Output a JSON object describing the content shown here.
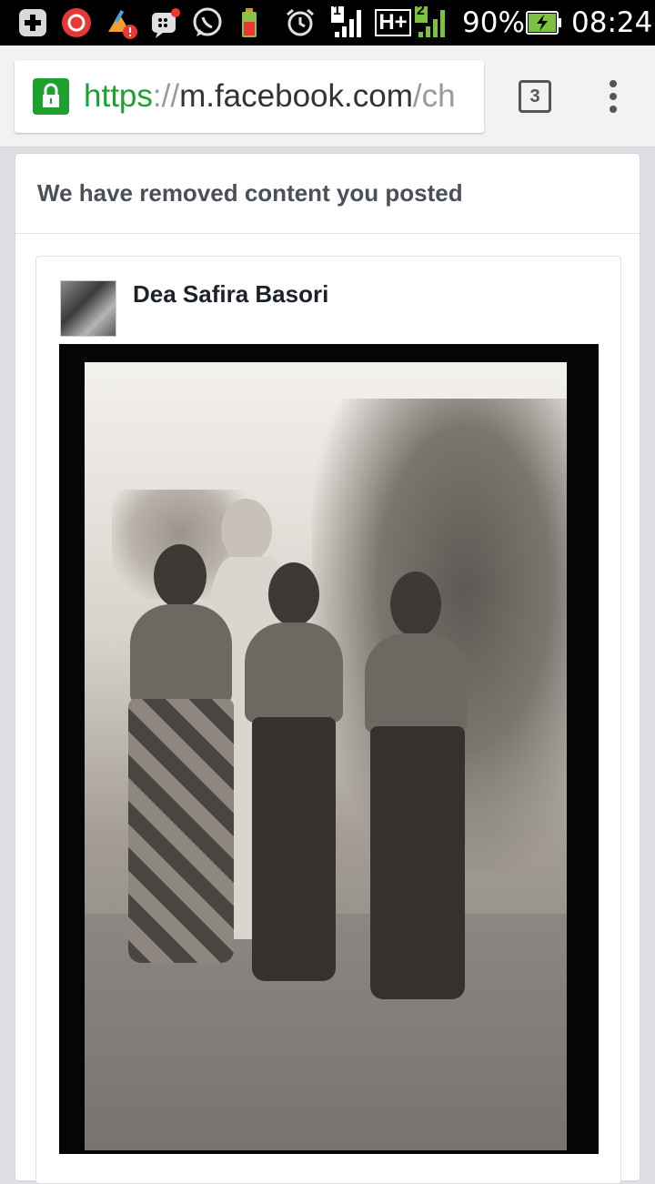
{
  "status_bar": {
    "battery": "90%",
    "time": "08:24",
    "network": "H+",
    "sim1": "1",
    "sim2": "2",
    "icons": [
      "add-icon",
      "sync-icon",
      "cleaner-alert-icon",
      "bbm-icon",
      "whatsapp-icon",
      "battery-app-icon",
      "alarm-icon",
      "signal-icon",
      "signal2-icon",
      "battery-charging-icon"
    ]
  },
  "browser": {
    "url_scheme": "https",
    "url_sep": "://",
    "url_host": "m.facebook.com",
    "url_path": "/ch",
    "tab_count": "3",
    "lock_color": "#1fa12f"
  },
  "notice": {
    "title": "We have removed content you posted"
  },
  "post": {
    "author": "Dea Safira Basori"
  }
}
